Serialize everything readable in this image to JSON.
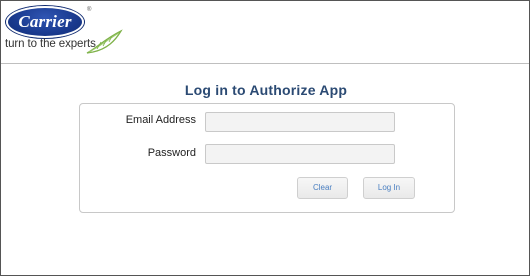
{
  "brand": {
    "name": "Carrier",
    "registered_mark": "®",
    "tagline": "turn to the experts",
    "logo_color": "#1a3a8f",
    "leaf_color": "#7fb24a"
  },
  "page": {
    "title": "Log in to Authorize App",
    "title_color": "#2b4a73"
  },
  "form": {
    "email_label": "Email Address",
    "email_value": "",
    "email_placeholder": "",
    "password_label": "Password",
    "password_value": "",
    "password_placeholder": "",
    "clear_label": "Clear",
    "login_label": "Log In",
    "button_text_color": "#4a7fc1"
  }
}
